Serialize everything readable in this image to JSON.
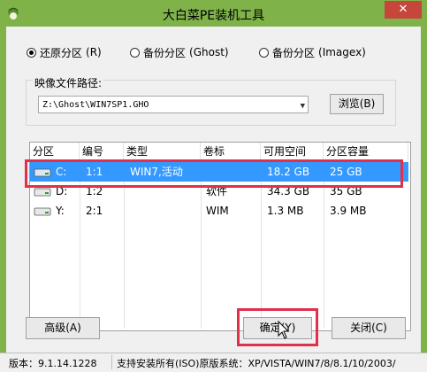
{
  "window": {
    "title": "大白菜PE装机工具",
    "close_label": "✕"
  },
  "modes": [
    {
      "label": "还原分区",
      "key": "(R)",
      "selected": true
    },
    {
      "label": "备份分区",
      "key": "(Ghost)",
      "selected": false
    },
    {
      "label": "备份分区",
      "key": "(Imagex)",
      "selected": false
    }
  ],
  "image_path": {
    "label": "映像文件路径:",
    "value": "Z:\\Ghost\\WIN7SP1.GHO",
    "browse_label": "浏览(B)"
  },
  "table": {
    "columns": [
      "分区",
      "编号",
      "类型",
      "卷标",
      "可用空间",
      "分区容量"
    ],
    "rows": [
      {
        "drive": "C:",
        "num": "1:1",
        "type": "WIN7,活动",
        "label": "",
        "free": "18.2 GB",
        "size": "25 GB",
        "selected": true
      },
      {
        "drive": "D:",
        "num": "1:2",
        "type": "",
        "label": "软件",
        "free": "34.3 GB",
        "size": "35 GB",
        "selected": false
      },
      {
        "drive": "Y:",
        "num": "2:1",
        "type": "",
        "label": "WIM",
        "free": "1.3 MB",
        "size": "3.9 MB",
        "selected": false
      }
    ]
  },
  "buttons": {
    "advanced": "高级(A)",
    "ok": "确定(Y)",
    "close": "关闭(C)"
  },
  "status": {
    "version": "版本：9.1.14.1228",
    "support": "支持安装所有(ISO)原版系统：XP/VISTA/WIN7/8/8.1/10/2003/"
  },
  "colors": {
    "frame": "#7fb34a",
    "selection": "#3399ff",
    "highlight": "#e0304a",
    "close": "#c7463b"
  }
}
